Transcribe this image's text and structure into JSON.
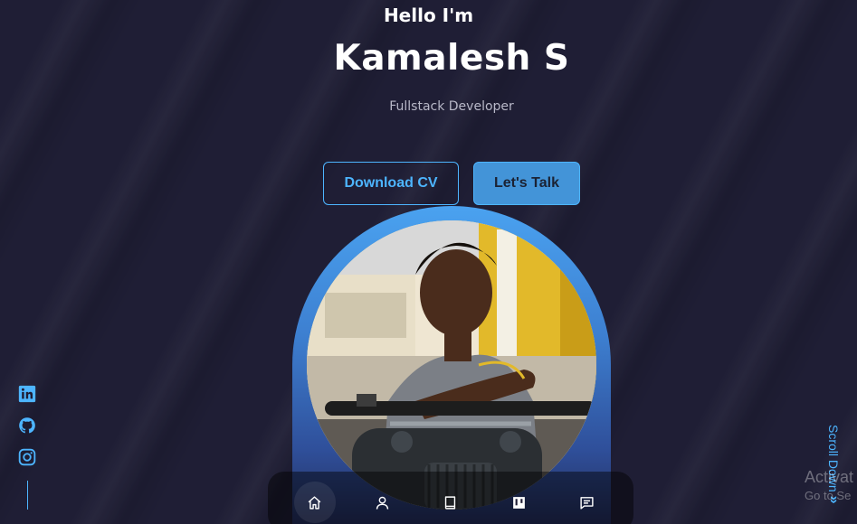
{
  "hero": {
    "greeting": "Hello I'm",
    "name": "Kamalesh S",
    "role": "Fullstack Developer"
  },
  "buttons": {
    "download_cv": "Download CV",
    "lets_talk": "Let's Talk"
  },
  "profile": {
    "accent": "#4db5ff"
  },
  "socials": [
    {
      "icon": "linkedin-icon"
    },
    {
      "icon": "github-icon"
    },
    {
      "icon": "instagram-icon"
    }
  ],
  "scroll": {
    "label": "Scroll Down",
    "chevrons": "»"
  },
  "watermark": {
    "title": "Activat",
    "subtitle": "Go to Se"
  },
  "nav": {
    "items": [
      {
        "icon": "home-icon",
        "active": true
      },
      {
        "icon": "user-icon",
        "active": false
      },
      {
        "icon": "book-icon",
        "active": false
      },
      {
        "icon": "portfolio-icon",
        "active": false
      },
      {
        "icon": "message-icon",
        "active": false
      }
    ]
  },
  "colors": {
    "background": "#1f1e35",
    "primary": "#4db5ff",
    "button_fill": "#4394d8",
    "text_muted": "#b8b8c8"
  }
}
